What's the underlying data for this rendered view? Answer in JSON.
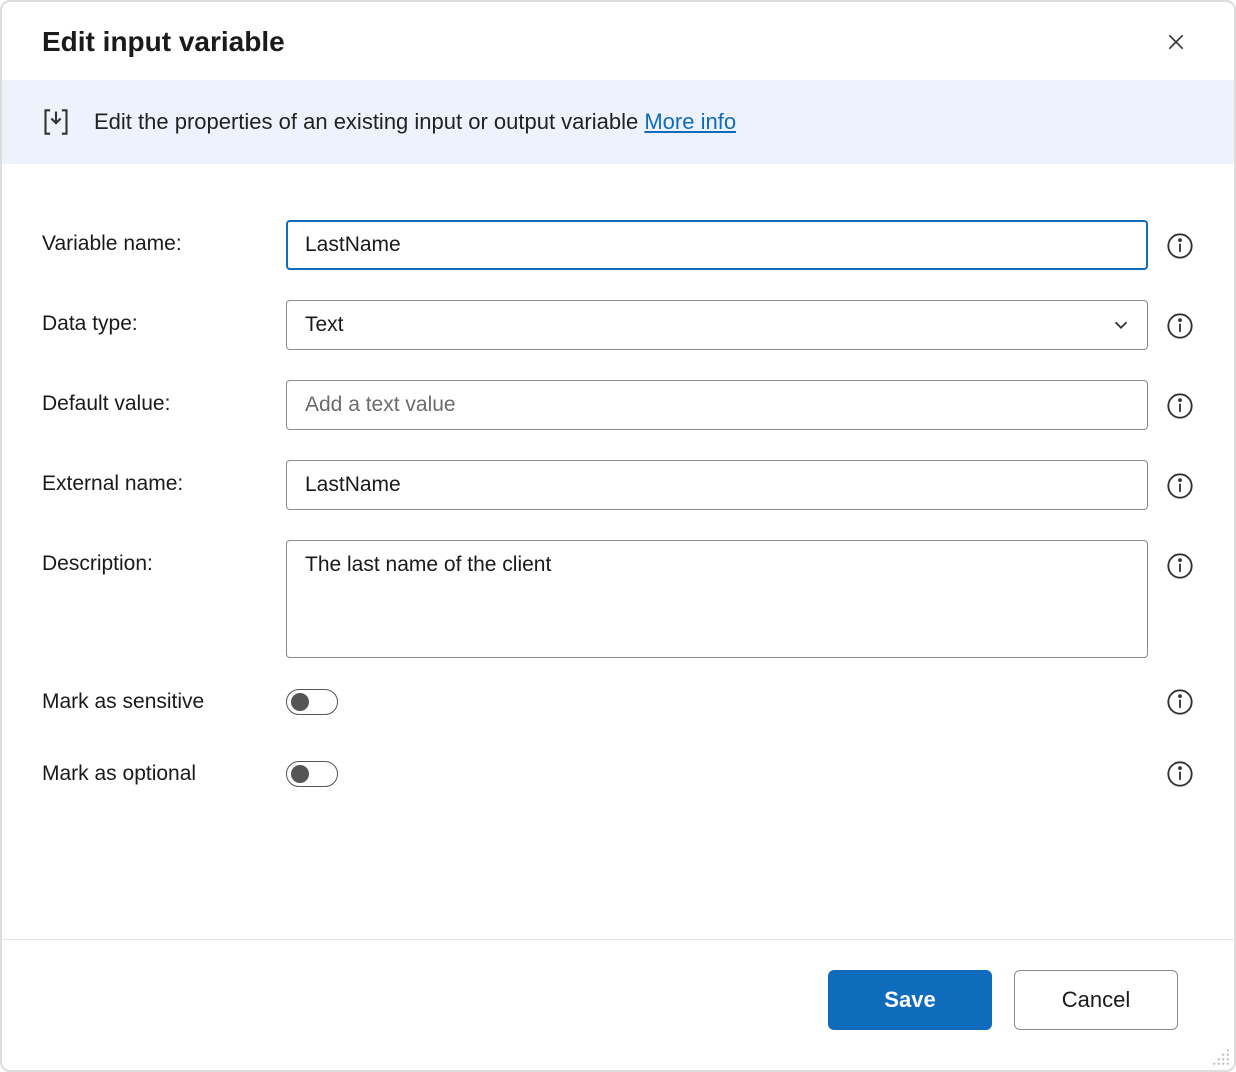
{
  "dialog": {
    "title": "Edit input variable",
    "banner": {
      "text": "Edit the properties of an existing input or output variable ",
      "link": "More info"
    }
  },
  "form": {
    "variable_name": {
      "label": "Variable name:",
      "value": "LastName"
    },
    "data_type": {
      "label": "Data type:",
      "value": "Text"
    },
    "default_value": {
      "label": "Default value:",
      "value": "",
      "placeholder": "Add a text value"
    },
    "external_name": {
      "label": "External name:",
      "value": "LastName"
    },
    "description": {
      "label": "Description:",
      "value": "The last name of the client"
    },
    "mark_sensitive": {
      "label": "Mark as sensitive",
      "on": false
    },
    "mark_optional": {
      "label": "Mark as optional",
      "on": false
    }
  },
  "footer": {
    "save": "Save",
    "cancel": "Cancel"
  }
}
